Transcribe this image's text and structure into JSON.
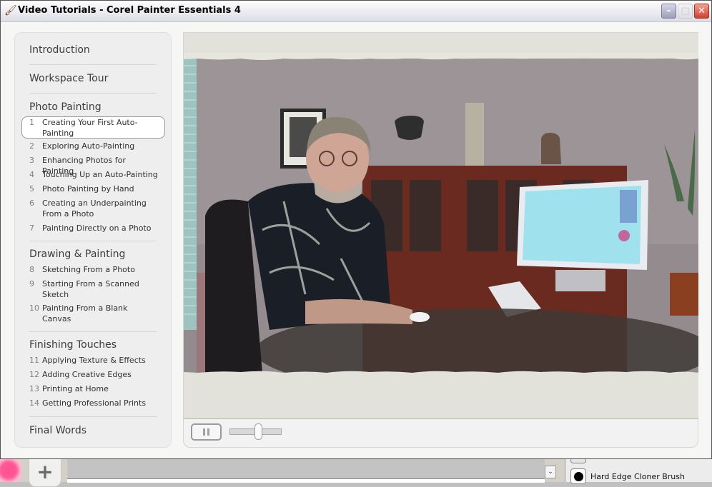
{
  "window": {
    "title": "Video Tutorials - Corel Painter Essentials 4",
    "app_icon": "paintbrush-icon",
    "buttons": {
      "minimize": "–",
      "maximize": "□",
      "close": "✕"
    }
  },
  "sidebar": {
    "sections": [
      {
        "title": "Introduction",
        "lessons": []
      },
      {
        "title": "Workspace Tour",
        "lessons": []
      },
      {
        "title": "Photo Painting",
        "lessons": [
          {
            "num": "1",
            "label": "Creating Your First Auto-Painting",
            "selected": true
          },
          {
            "num": "2",
            "label": "Exploring Auto-Painting"
          },
          {
            "num": "3",
            "label": "Enhancing Photos for Painting"
          },
          {
            "num": "4",
            "label": "Touching Up an Auto-Painting"
          },
          {
            "num": "5",
            "label": "Photo Painting by Hand"
          },
          {
            "num": "6",
            "label": "Creating an Underpainting From a Photo"
          },
          {
            "num": "7",
            "label": "Painting Directly on a Photo"
          }
        ]
      },
      {
        "title": "Drawing & Painting",
        "lessons": [
          {
            "num": "8",
            "label": "Sketching From a Photo"
          },
          {
            "num": "9",
            "label": "Starting From a Scanned Sketch"
          },
          {
            "num": "10",
            "label": "Painting From a Blank Canvas"
          }
        ]
      },
      {
        "title": "Finishing Touches",
        "lessons": [
          {
            "num": "11",
            "label": "Applying Texture & Effects"
          },
          {
            "num": "12",
            "label": "Adding Creative Edges"
          },
          {
            "num": "13",
            "label": "Printing at Home"
          },
          {
            "num": "14",
            "label": "Getting Professional Prints"
          }
        ]
      },
      {
        "title": "Final Words",
        "lessons": []
      }
    ]
  },
  "player": {
    "state": "playing",
    "pause_icon": "pause-icon",
    "volume": 0.55
  },
  "background_app": {
    "plus_label": "+",
    "dropdown_glyph": "⌄",
    "brush_item_label": "Hard Edge Cloner Brush",
    "accent_pink": "#ff4f8f"
  }
}
